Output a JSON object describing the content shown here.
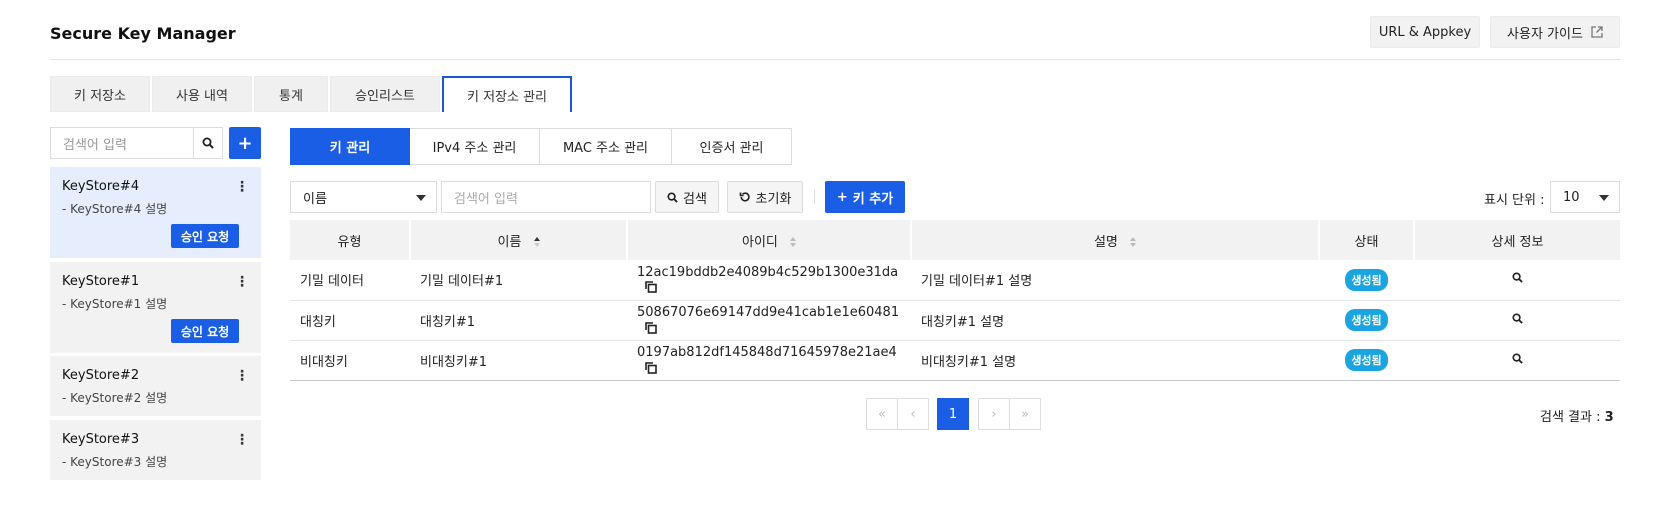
{
  "app": {
    "title": "Secure Key Manager",
    "url_appkey_label": "URL & Appkey",
    "user_guide_label": "사용자 가이드"
  },
  "tabs": [
    {
      "label": "키 저장소",
      "active": false
    },
    {
      "label": "사용 내역",
      "active": false
    },
    {
      "label": "통계",
      "active": false
    },
    {
      "label": "승인리스트",
      "active": false
    },
    {
      "label": "키 저장소 관리",
      "active": true
    }
  ],
  "sidebar": {
    "search_placeholder": "검색어 입력",
    "keystores": [
      {
        "name": "KeyStore#4",
        "desc": "- KeyStore#4 설명",
        "approve_label": "승인 요청",
        "selected": true
      },
      {
        "name": "KeyStore#1",
        "desc": "- KeyStore#1 설명",
        "approve_label": "승인 요청",
        "selected": false
      },
      {
        "name": "KeyStore#2",
        "desc": "- KeyStore#2 설명",
        "selected": false
      },
      {
        "name": "KeyStore#3",
        "desc": "- KeyStore#3 설명",
        "selected": false
      }
    ]
  },
  "subtabs": [
    {
      "label": "키 관리",
      "active": true
    },
    {
      "label": "IPv4 주소 관리",
      "active": false
    },
    {
      "label": "MAC 주소 관리",
      "active": false
    },
    {
      "label": "인증서 관리",
      "active": false
    }
  ],
  "filter": {
    "field_value": "이름",
    "search_placeholder": "검색어 입력",
    "search_label": "검색",
    "reset_label": "초기화",
    "add_key_label": "키 추가",
    "page_size_label": "표시 단위 :",
    "page_size_value": "10"
  },
  "table": {
    "headers": [
      "유형",
      "이름",
      "아이디",
      "설명",
      "상태",
      "상세 정보"
    ],
    "rows": [
      {
        "type": "기밀 데이터",
        "name": "기밀 데이터#1",
        "id": "12ac19bddb2e4089b4c529b1300e31da",
        "desc": "기밀 데이터#1 설명",
        "status": "생성됨"
      },
      {
        "type": "대칭키",
        "name": "대칭키#1",
        "id": "50867076e69147dd9e41cab1e1e60481",
        "desc": "대칭키#1 설명",
        "status": "생성됨"
      },
      {
        "type": "비대칭키",
        "name": "비대칭키#1",
        "id": "0197ab812df145848d71645978e21ae4",
        "desc": "비대칭키#1 설명",
        "status": "생성됨"
      }
    ]
  },
  "pagination": {
    "current_page": "1",
    "result_label": "검색 결과 :",
    "result_count": "3"
  },
  "colors": {
    "accent": "#1a5ee6",
    "status_badge": "#1aa5e0"
  }
}
